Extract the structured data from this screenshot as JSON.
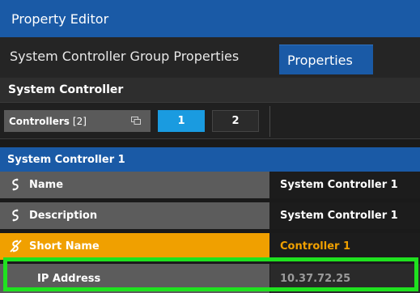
{
  "panel": {
    "title": "Property Editor"
  },
  "tabs": [
    {
      "label": "System Controller Group Properties"
    },
    {
      "label": "Properties"
    }
  ],
  "section": {
    "title": "System Controller"
  },
  "controllers": {
    "label": "Controllers",
    "count": "[2]",
    "buttons": [
      "1",
      "2"
    ],
    "selected": "1"
  },
  "subsection": {
    "title": "System Controller 1"
  },
  "properties": [
    {
      "label": "Name",
      "value": "System Controller 1",
      "icon": "link-icon"
    },
    {
      "label": "Description",
      "value": "System Controller 1",
      "icon": "link-icon"
    },
    {
      "label": "Short Name",
      "value": "Controller 1",
      "icon": "unlink-icon"
    },
    {
      "label": "IP Address",
      "value": "10.37.72.25"
    }
  ],
  "colors": {
    "accent": "#1a5aa6",
    "selected_button": "#1a9be0",
    "warning": "#f0a000",
    "highlight": "#1fe11f"
  }
}
